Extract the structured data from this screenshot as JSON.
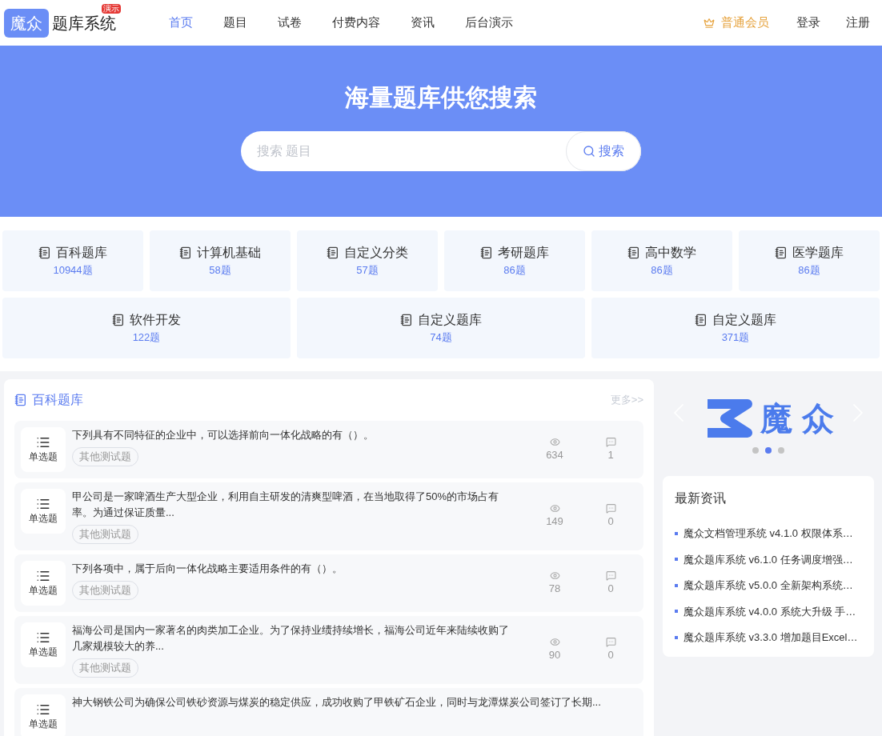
{
  "header": {
    "logo_mark": "魔众",
    "logo_text": "题库系统",
    "logo_badge": "演示",
    "nav": [
      {
        "label": "首页",
        "selected": true
      },
      {
        "label": "题目",
        "selected": false
      },
      {
        "label": "试卷",
        "selected": false
      },
      {
        "label": "付费内容",
        "selected": false
      },
      {
        "label": "资讯",
        "selected": false
      },
      {
        "label": "后台演示",
        "selected": false
      }
    ],
    "member": "普通会员",
    "login": "登录",
    "register": "注册"
  },
  "hero": {
    "title": "海量题库供您搜索",
    "search": {
      "placeholder": "搜索 题目",
      "button": "搜索"
    }
  },
  "categories": [
    {
      "name": "百科题库",
      "count": "10944题"
    },
    {
      "name": "计算机基础",
      "count": "58题"
    },
    {
      "name": "自定义分类",
      "count": "57题"
    },
    {
      "name": "考研题库",
      "count": "86题"
    },
    {
      "name": "高中数学",
      "count": "86题"
    },
    {
      "name": "医学题库",
      "count": "86题"
    },
    {
      "name": "软件开发",
      "count": "122题"
    },
    {
      "name": "自定义题库",
      "count": "74题"
    },
    {
      "name": "自定义题库",
      "count": "371题"
    }
  ],
  "question_panel": {
    "title": "百科题库",
    "more": "更多>>",
    "questions": [
      {
        "type": "单选题",
        "text": "下列具有不同特征的企业中，可以选择前向一体化战略的有（）。",
        "tag": "其他测试题",
        "views": "634",
        "comments": "1"
      },
      {
        "type": "单选题",
        "text": "甲公司是一家啤酒生产大型企业，利用自主研发的清爽型啤酒，在当地取得了50%的市场占有率。为通过保证质量...",
        "tag": "其他测试题",
        "views": "149",
        "comments": "0"
      },
      {
        "type": "单选题",
        "text": "下列各项中，属于后向一体化战略主要适用条件的有（）。",
        "tag": "其他测试题",
        "views": "78",
        "comments": "0"
      },
      {
        "type": "单选题",
        "text": "福海公司是国内一家著名的肉类加工企业。为了保持业绩持续增长，福海公司近年来陆续收购了几家规模较大的养...",
        "tag": "其他测试题",
        "views": "90",
        "comments": "0"
      },
      {
        "type": "单选题",
        "text": "神大钢铁公司为确保公司铁砂资源与煤炭的稳定供应，成功收购了甲铁矿石企业，同时与龙潭煤炭公司签订了长期..."
      }
    ]
  },
  "carousel": {
    "logo_text": "魔 众",
    "dots": [
      {
        "selected": false
      },
      {
        "selected": true
      },
      {
        "selected": false
      }
    ]
  },
  "news": {
    "title": "最新资讯",
    "items": [
      "魔众文档管理系统 v4.1.0 权限体系…",
      "魔众题库系统 v6.1.0 任务调度增强…",
      "魔众题库系统 v5.0.0 全新架构系统…",
      "魔众题库系统 v4.0.0 系统大升级 手…",
      "魔众题库系统 v3.3.0 增加题目Excel…"
    ]
  }
}
